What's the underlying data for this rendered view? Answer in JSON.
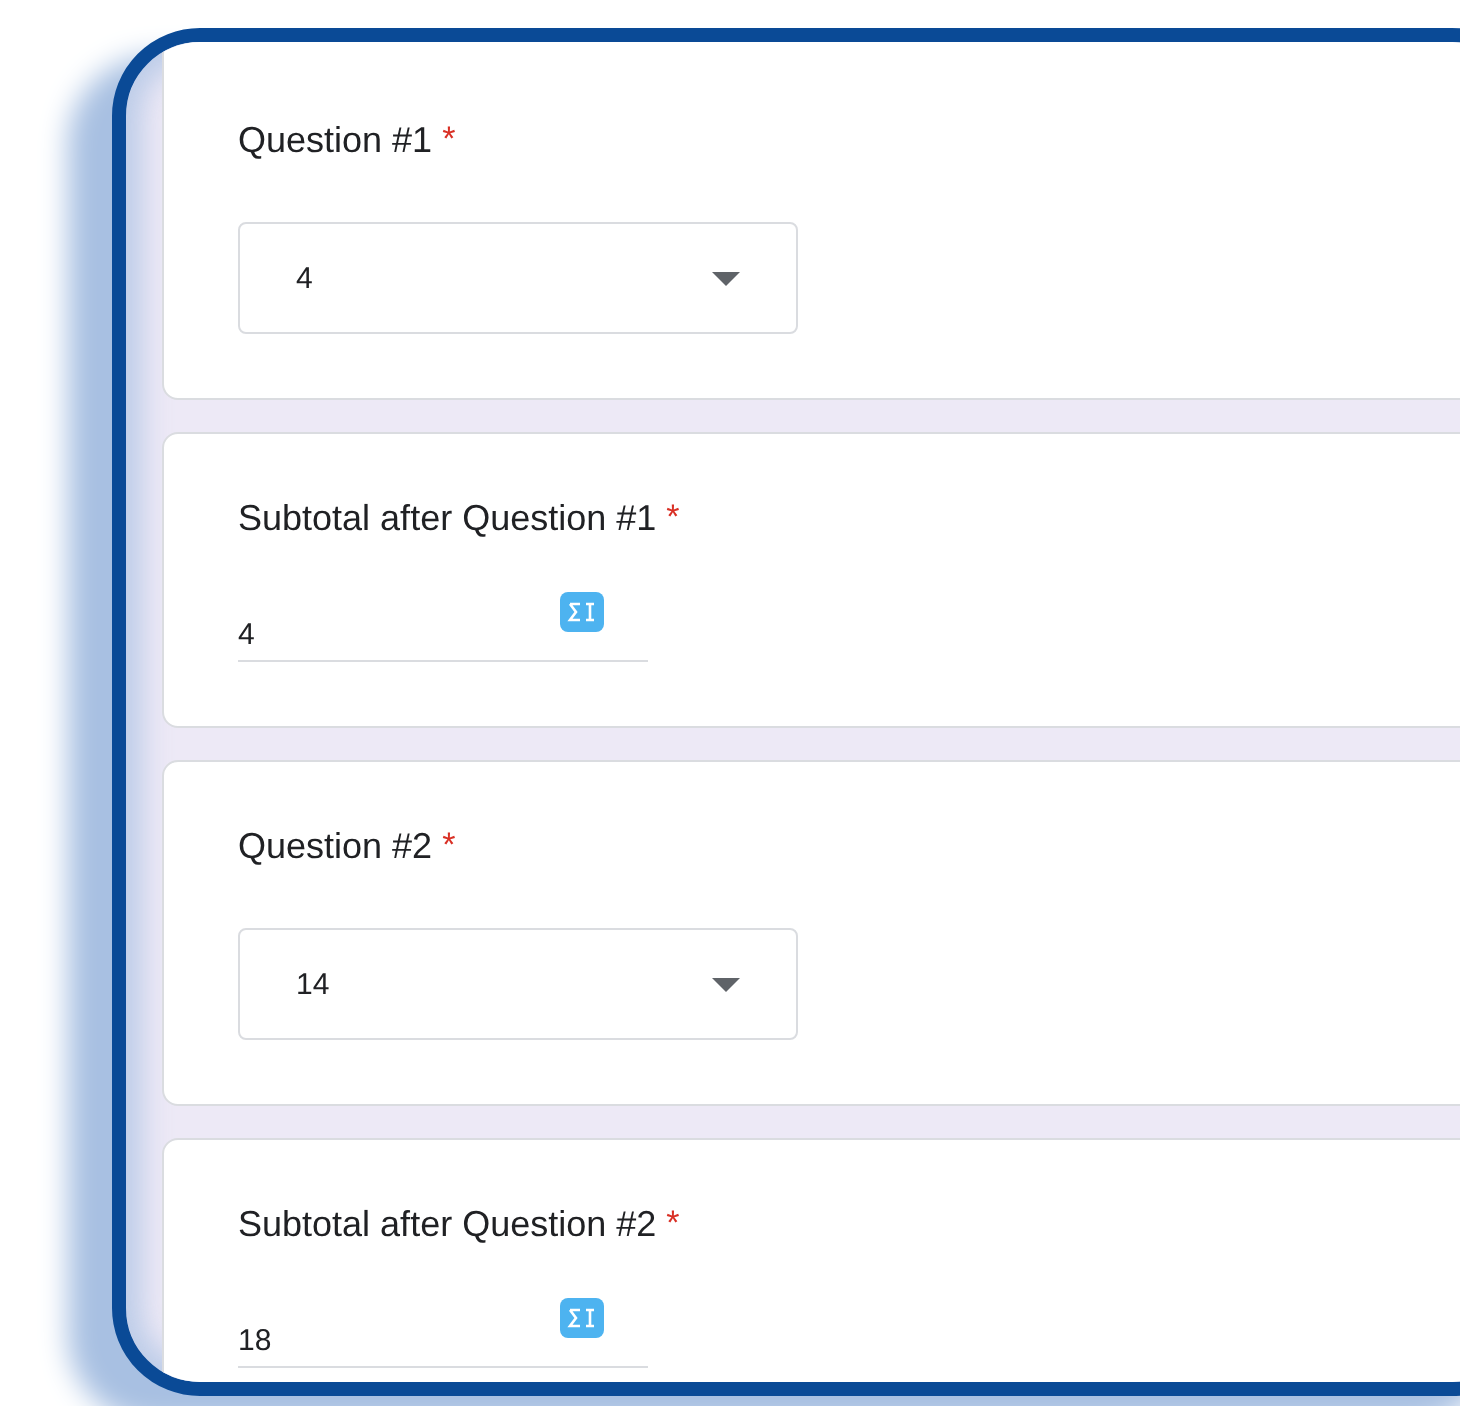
{
  "questions": [
    {
      "kind": "dropdown",
      "title": "Question #1",
      "required_mark": "*",
      "value": "4"
    },
    {
      "kind": "formula",
      "title": "Subtotal after Question #1",
      "required_mark": "*",
      "value": "4"
    },
    {
      "kind": "dropdown",
      "title": "Question #2",
      "required_mark": "*",
      "value": "14"
    },
    {
      "kind": "formula",
      "title": "Subtotal after Question #2",
      "required_mark": "*",
      "value": "18"
    }
  ]
}
